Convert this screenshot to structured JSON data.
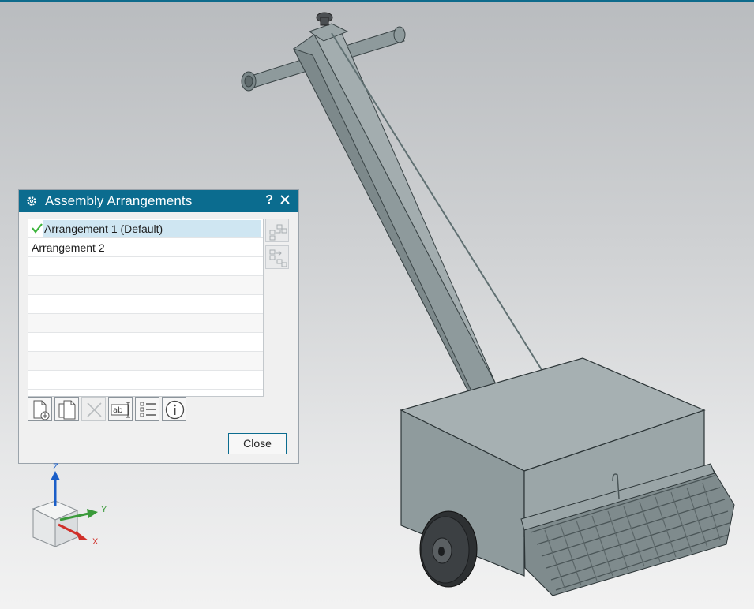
{
  "dialog": {
    "title": "Assembly Arrangements",
    "help_label": "?",
    "arrangements": [
      {
        "label": "Arrangement 1 (Default)",
        "active": true
      },
      {
        "label": "Arrangement 2",
        "active": false
      }
    ],
    "close_label": "Close"
  },
  "triad": {
    "z_label": "Z",
    "y_label": "Y",
    "x_label": "X"
  },
  "colors": {
    "titlebar": "#0b6c8f",
    "selection": "#cfe6f2",
    "check": "#3cb43c",
    "model": "#8e9a9c",
    "z_axis": "#1a5ec8",
    "y_axis": "#3a9a3a",
    "x_axis": "#d0302a"
  }
}
